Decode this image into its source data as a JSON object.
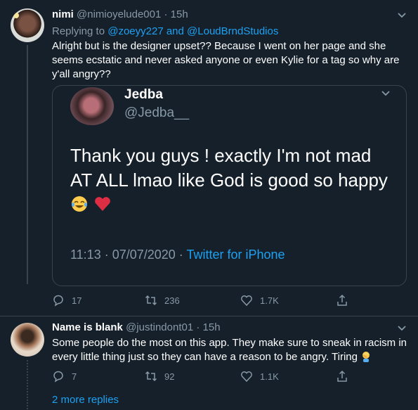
{
  "tweet1": {
    "name": "nimi",
    "handle": "@nimioyelude001",
    "time": "· 15h",
    "replying_prefix": "Replying to",
    "replying_to_1": "@zoeyy227",
    "replying_and": "and",
    "replying_to_2": "@LoudBrndStudios",
    "text": "Alright but is the designer upset?? Because I went on her page and she seems ecstatic and never asked anyone or even Kylie for a tag so why are y'all angry??",
    "replies": "17",
    "retweets": "236",
    "likes": "1.7K"
  },
  "quoted": {
    "name": "Jedba",
    "handle": "@Jedba__",
    "text": "Thank you guys ! exactly I'm not mad AT ALL lmao like God is good so happy",
    "time": "11:13 · 07/07/2020 ·",
    "source": "Twitter for iPhone"
  },
  "tweet2": {
    "name": "Name is blank",
    "handle": "@justindont01",
    "time": "· 15h",
    "text": "Some people do the most on this app. They make sure to sneak in racism in every little thing just so they can have a reason to be angry. Tiring",
    "replies": "7",
    "retweets": "92",
    "likes": "1.1K"
  },
  "more_replies": "2 more replies",
  "colors": {
    "background": "#15202b",
    "accent": "#1da1f2",
    "muted": "#8899a6",
    "border": "#38444d"
  },
  "icons": [
    "reply-icon",
    "retweet-icon",
    "like-icon",
    "share-icon",
    "chevron-down-icon"
  ]
}
